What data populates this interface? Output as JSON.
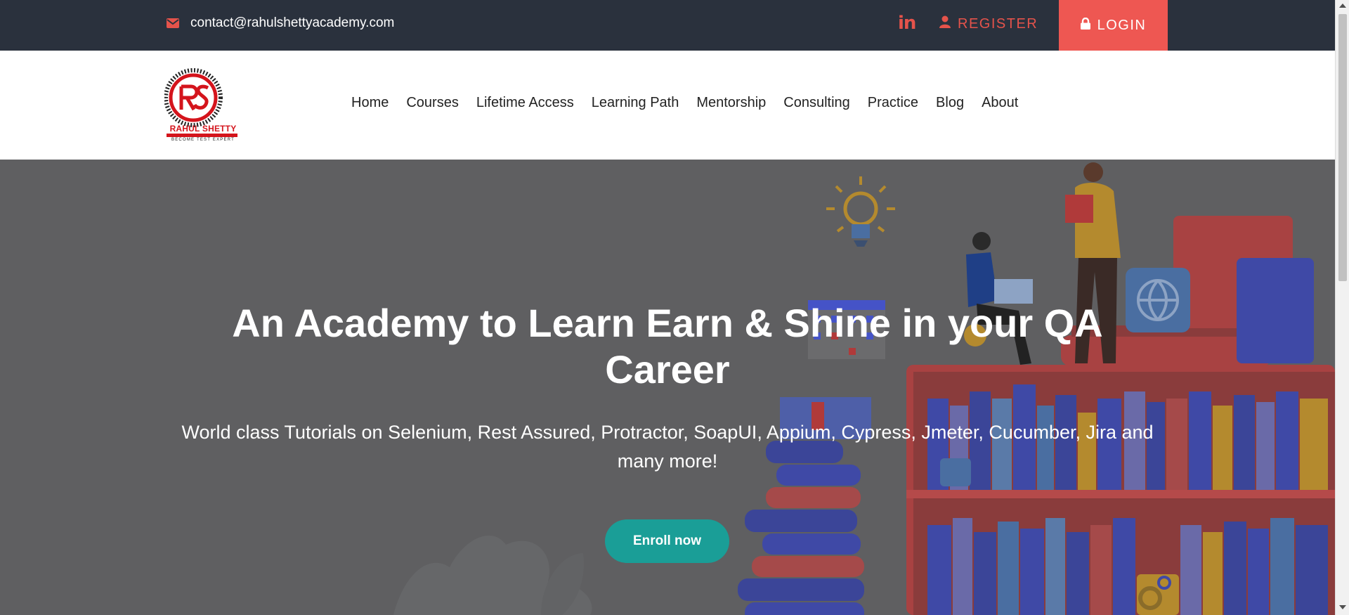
{
  "topbar": {
    "email": "contact@rahulshettyacademy.com",
    "linkedin_label": "in",
    "register_label": "REGISTER",
    "login_label": "LOGIN",
    "background_color": "#2a313d",
    "accent_color": "#ee5752"
  },
  "logo": {
    "brand_name": "RAHUL SHETTY",
    "tagline": "BECOME TEST EXPERT",
    "monogram": "RS"
  },
  "nav": {
    "items": [
      {
        "label": "Home"
      },
      {
        "label": "Courses"
      },
      {
        "label": "Lifetime Access"
      },
      {
        "label": "Learning Path"
      },
      {
        "label": "Mentorship"
      },
      {
        "label": "Consulting"
      },
      {
        "label": "Practice"
      },
      {
        "label": "Blog"
      },
      {
        "label": "About"
      }
    ]
  },
  "hero": {
    "title": "An Academy to Learn Earn & Shine in your QA Career",
    "subtitle": "World class Tutorials on Selenium, Rest Assured, Protractor, SoapUI, Appium, Cypress, Jmeter, Cucumber, Jira and many more!",
    "cta_label": "Enroll now",
    "cta_color": "#1a9e97",
    "overlay_color": "#5f5f61"
  },
  "icons": {
    "email": "envelope-icon",
    "linkedin": "linkedin-icon",
    "register": "user-icon",
    "login": "lock-icon"
  }
}
